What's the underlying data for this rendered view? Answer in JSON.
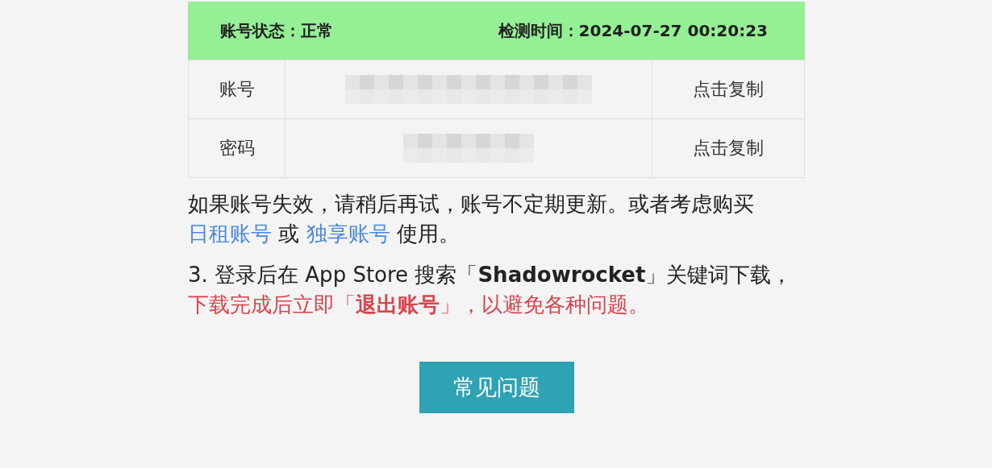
{
  "status_bar": {
    "status": "账号状态：正常",
    "checked_time": "检测时间：2024-07-27 00:20:23"
  },
  "credentials": [
    {
      "label": "账号",
      "copy": "点击复制"
    },
    {
      "label": "密码",
      "copy": "点击复制"
    }
  ],
  "notes": [
    {
      "segments": [
        {
          "kind": "plain",
          "text": "如果账号失效，请稍后再试，账号不定期更新。或者考虑购买 "
        },
        {
          "kind": "link",
          "text": "日租账号"
        },
        {
          "kind": "plain",
          "text": " 或 "
        },
        {
          "kind": "link",
          "text": "独享账号"
        },
        {
          "kind": "plain",
          "text": " 使用。"
        }
      ]
    },
    {
      "segments": [
        {
          "kind": "plain",
          "text": "3. 登录后在 App Store 搜索「**Shadowrocket**」关键词下载，"
        },
        {
          "kind": "warning",
          "text": "下载完成后立即「**退出账号**」，以避免各种问题。"
        }
      ]
    }
  ],
  "faq_button": "常见问题"
}
